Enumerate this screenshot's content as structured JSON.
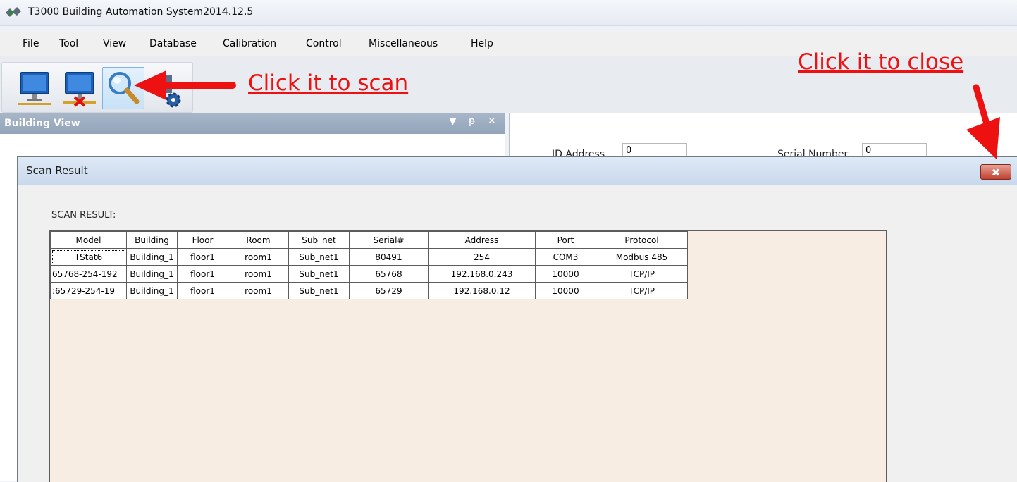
{
  "app": {
    "title": "T3000 Building Automation System2014.12.5"
  },
  "menu": [
    "File",
    "Tool",
    "View",
    "Database",
    "Calibration",
    "Control",
    "Miscellaneous",
    "Help"
  ],
  "annotations": {
    "scan": "Click it to scan",
    "close": "Click it to close"
  },
  "toolbar": {
    "buttons": [
      "connect-icon",
      "disconnect-icon",
      "scan-icon",
      "settings-icon"
    ],
    "active": "scan-icon"
  },
  "building_view": {
    "title": "Building View",
    "pin": " ⬇",
    "close": "✕"
  },
  "right_pane": {
    "id_label": "ID Address",
    "id_value": "0",
    "serial_label": "Serial Number",
    "serial_value": "0"
  },
  "dialog": {
    "title": "Scan Result",
    "close_label": "✖",
    "section_label": "SCAN RESULT:",
    "columns": [
      "Model",
      "Building",
      "Floor",
      "Room",
      "Sub_net",
      "Serial#",
      "Address",
      "Port",
      "Protocol"
    ],
    "rows": [
      [
        "TStat6",
        "Building_1",
        "floor1",
        "room1",
        "Sub_net1",
        "80491",
        "254",
        "COM3",
        "Modbus 485"
      ],
      [
        "65768-254-192",
        "Building_1",
        "floor1",
        "room1",
        "Sub_net1",
        "65768",
        "192.168.0.243",
        "10000",
        "TCP/IP"
      ],
      [
        ":65729-254-19",
        "Building_1",
        "floor1",
        "room1",
        "Sub_net1",
        "65729",
        "192.168.0.12",
        "10000",
        "TCP/IP"
      ]
    ]
  },
  "colors": {
    "annotation": "#ee1111",
    "grid_bg": "#f8ede2",
    "close_btn": "#c2412f"
  }
}
